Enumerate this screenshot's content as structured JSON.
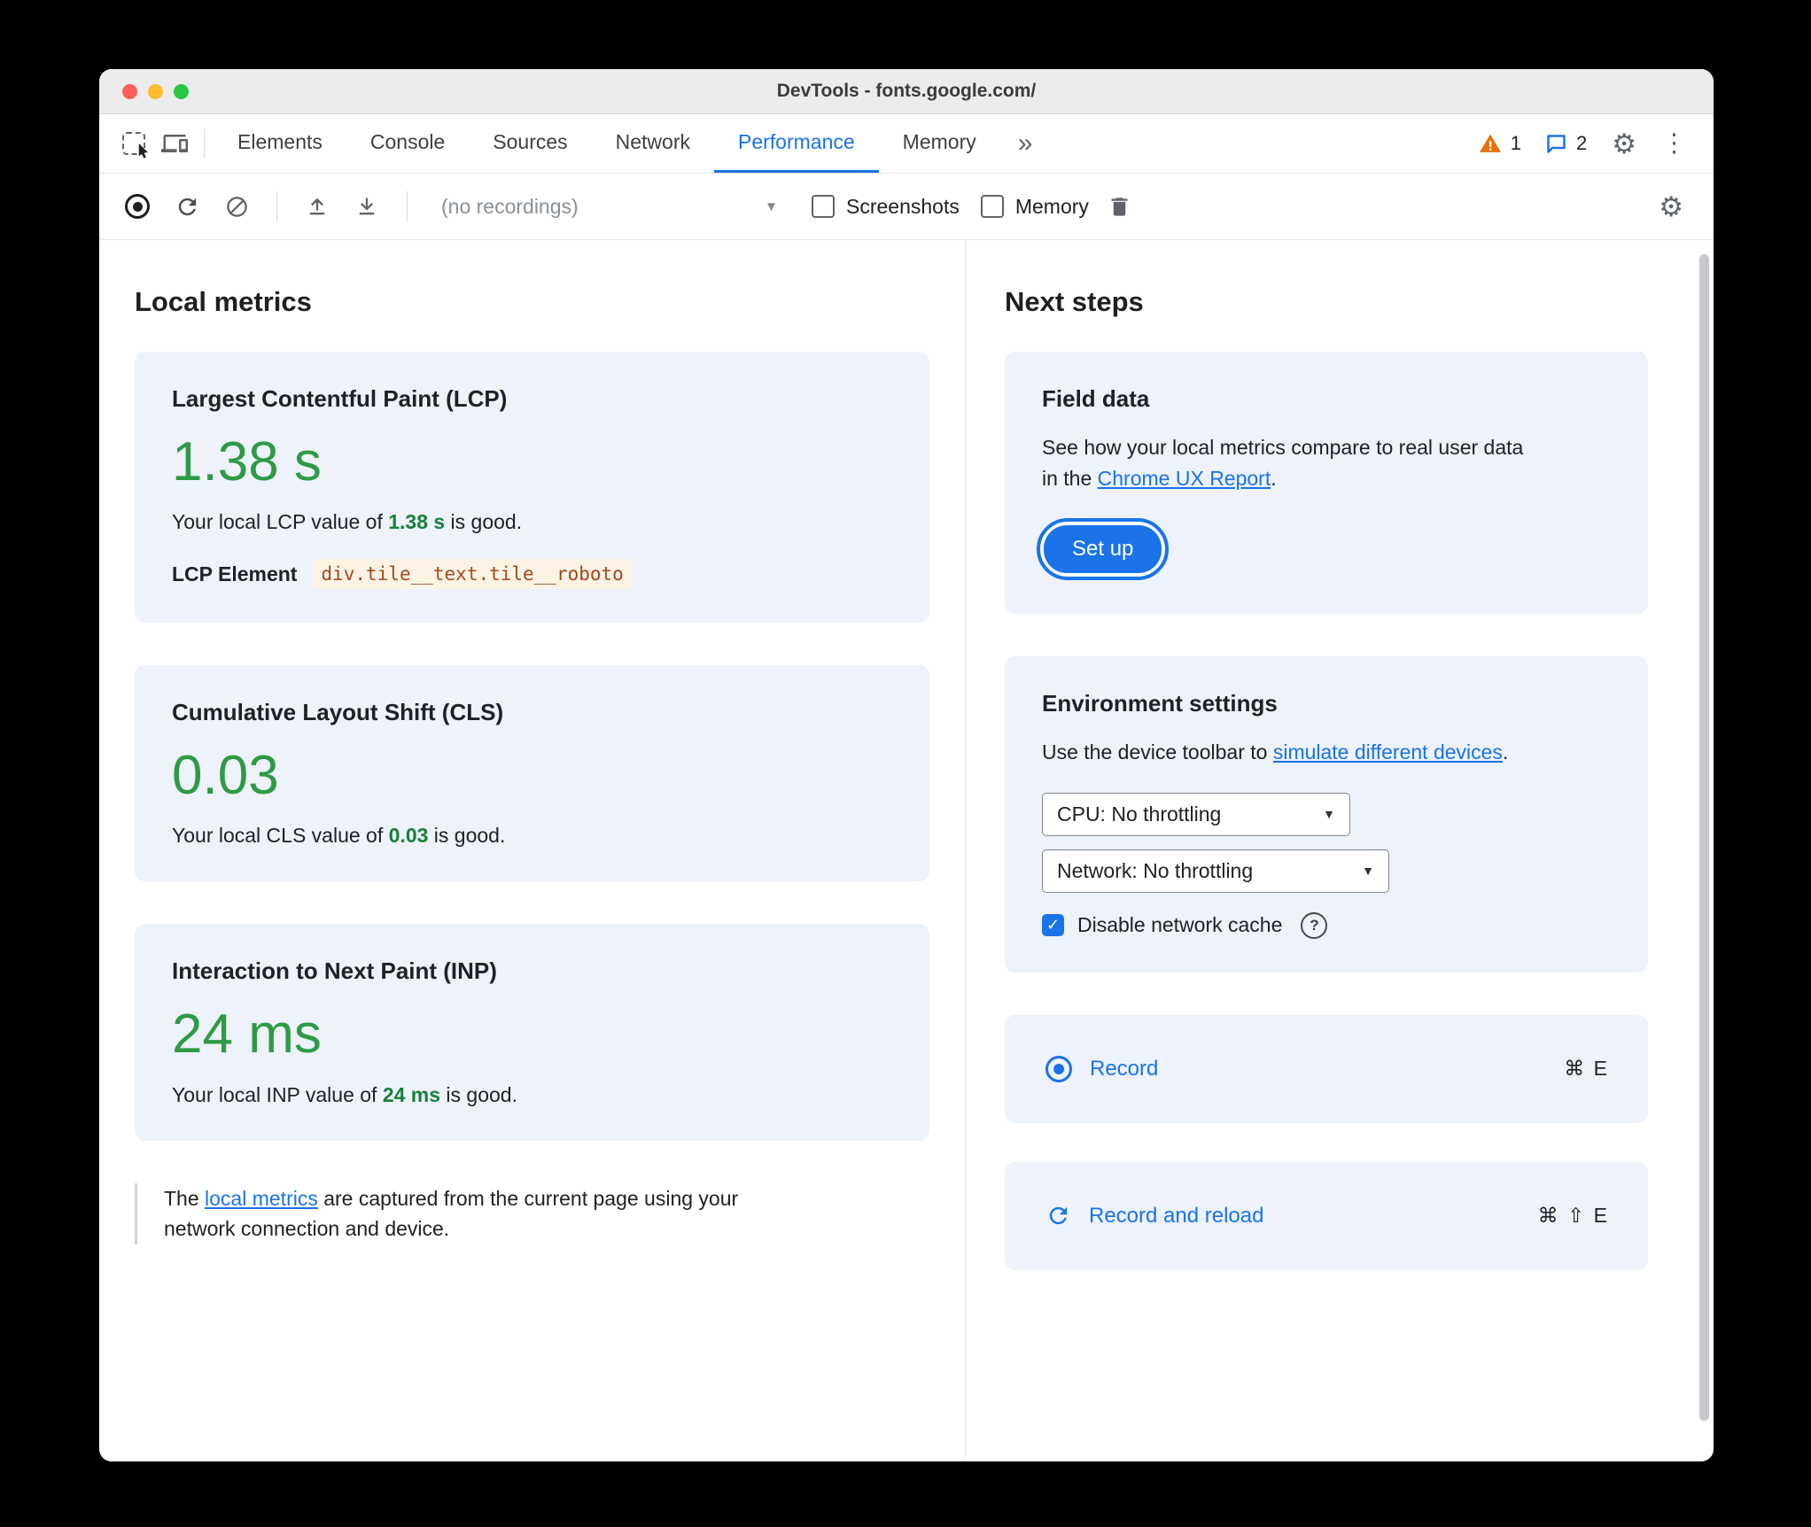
{
  "window": {
    "title": "DevTools - fonts.google.com/"
  },
  "tabbar": {
    "tabs": [
      {
        "label": "Elements"
      },
      {
        "label": "Console"
      },
      {
        "label": "Sources"
      },
      {
        "label": "Network"
      },
      {
        "label": "Performance"
      },
      {
        "label": "Memory"
      }
    ],
    "active_tab": "Performance",
    "more_tabs_glyph": "»",
    "warning_count": "1",
    "issues_count": "2"
  },
  "toolbar": {
    "recordings_dropdown": "(no recordings)",
    "screenshots_label": "Screenshots",
    "memory_label": "Memory"
  },
  "icons": {
    "settings_glyph": "⚙",
    "more_menu_glyph": "⋮",
    "dropdown_glyph": "▼",
    "check_glyph": "✓",
    "help_glyph": "?"
  },
  "local_metrics": {
    "heading": "Local metrics",
    "lcp": {
      "title": "Largest Contentful Paint (LCP)",
      "value": "1.38 s",
      "desc_prefix": "Your local LCP value of ",
      "desc_highlight": "1.38 s",
      "desc_suffix": " is good.",
      "element_label": "LCP Element",
      "element_selector": "div.tile__text.tile__roboto"
    },
    "cls": {
      "title": "Cumulative Layout Shift (CLS)",
      "value": "0.03",
      "desc_prefix": "Your local CLS value of ",
      "desc_highlight": "0.03",
      "desc_suffix": " is good."
    },
    "inp": {
      "title": "Interaction to Next Paint (INP)",
      "value": "24 ms",
      "desc_prefix": "Your local INP value of ",
      "desc_highlight": "24 ms",
      "desc_suffix": " is good."
    },
    "footnote": {
      "prefix": "The ",
      "link_text": "local metrics",
      "suffix": " are captured from the current page using your network connection and device."
    }
  },
  "next_steps": {
    "heading": "Next steps",
    "field_data": {
      "title": "Field data",
      "desc_prefix": "See how your local metrics compare to real user data in the ",
      "link_text": "Chrome UX Report",
      "desc_suffix": ".",
      "setup_button": "Set up"
    },
    "environment": {
      "title": "Environment settings",
      "desc_prefix": "Use the device toolbar to ",
      "link_text": "simulate different devices",
      "desc_suffix": ".",
      "cpu_select": "CPU: No throttling",
      "network_select": "Network: No throttling",
      "cache_checkbox_label": "Disable network cache"
    },
    "record": {
      "label": "Record",
      "shortcut": "⌘ E"
    },
    "record_and_reload": {
      "label": "Record and reload",
      "shortcut": "⌘ ⇧ E"
    }
  },
  "colors": {
    "accent_blue": "#1a73e8",
    "metric_green": "#2e9b44",
    "inline_green": "#188038",
    "warning_orange": "#e8710a",
    "card_background": "#edf2fb"
  }
}
